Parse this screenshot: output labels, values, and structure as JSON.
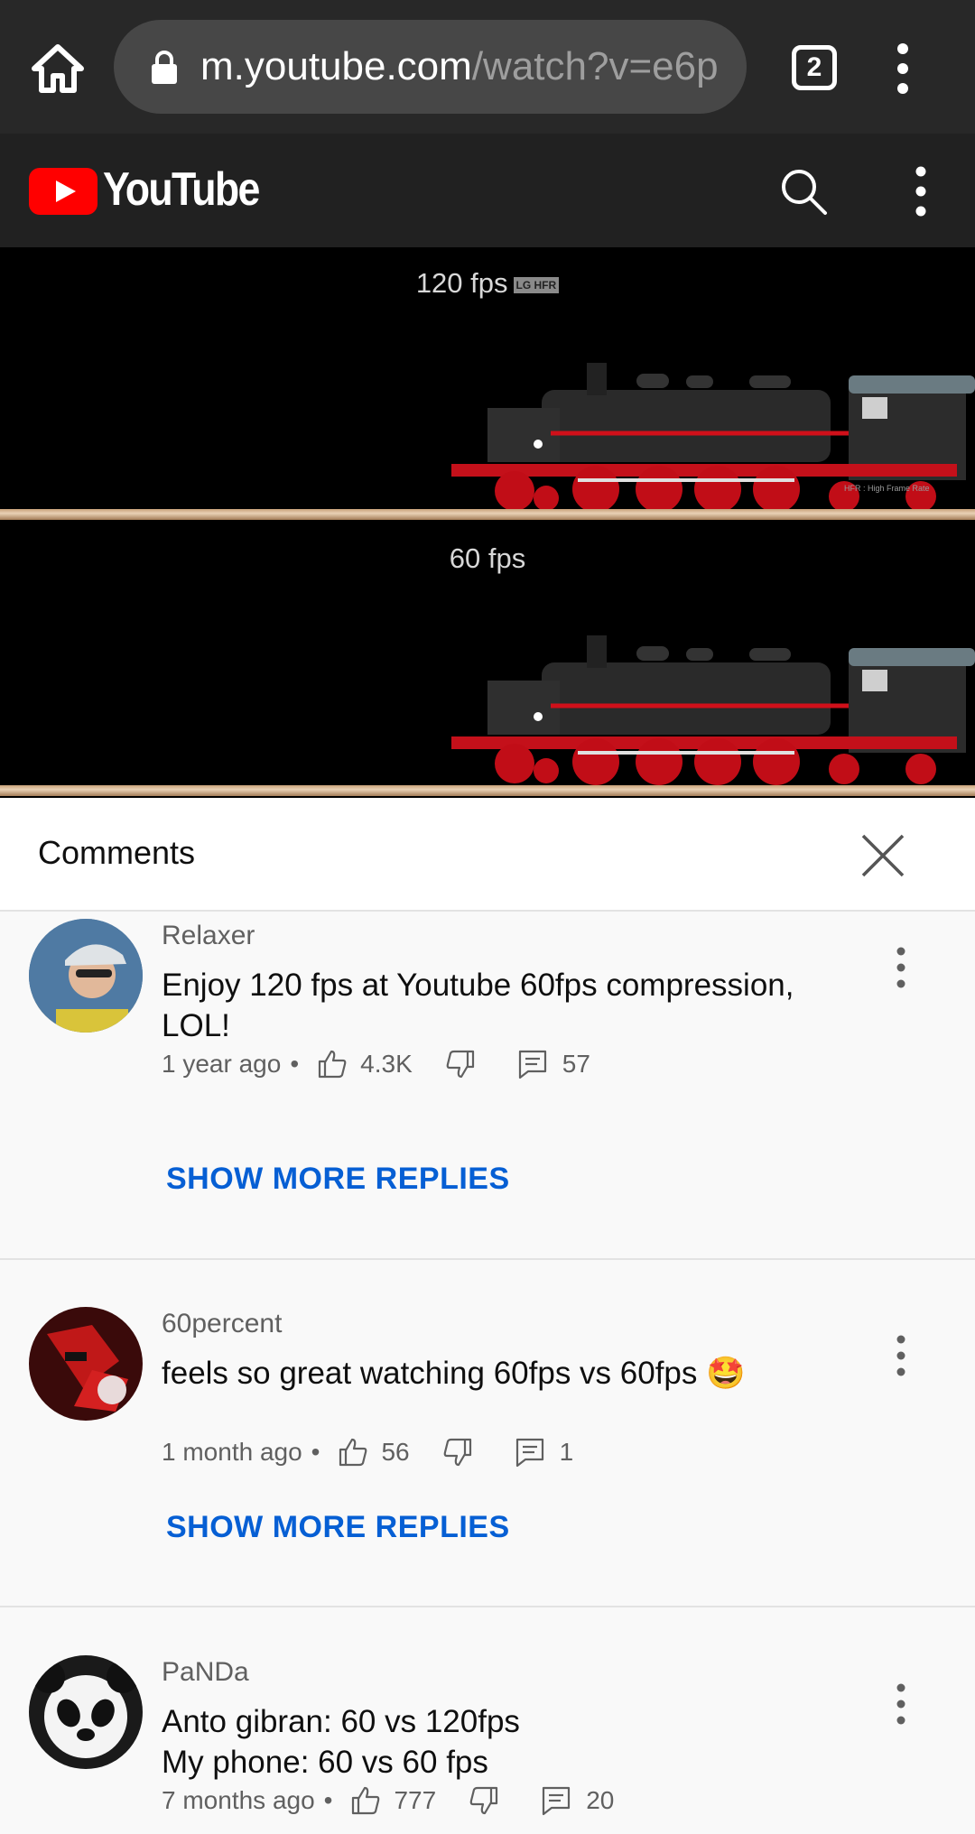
{
  "browser": {
    "url_host": "m.youtube.com",
    "url_path": "/watch?v=e6p",
    "tab_count": "2"
  },
  "youtube": {
    "wordmark": "YouTube"
  },
  "video": {
    "top_label": "120 fps",
    "top_badge": "LG HFR",
    "bottom_label": "60 fps",
    "watermark": "HFR : High Frame Rate"
  },
  "comments": {
    "title": "Comments",
    "items": [
      {
        "author": "Relaxer",
        "text_line1": "Enjoy 120 fps at Youtube 60fps compression,",
        "text_line2": "LOL!",
        "time": "1 year ago",
        "likes": "4.3K",
        "replies": "57",
        "more_replies": "SHOW MORE REPLIES"
      },
      {
        "author": "60percent",
        "text_line1": "feels so great watching 60fps vs 60fps 🤩",
        "time": "1 month ago",
        "likes": "56",
        "replies": "1",
        "more_replies": "SHOW MORE REPLIES"
      },
      {
        "author": "PaNDa",
        "text_line1": "Anto gibran: 60 vs 120fps",
        "text_line2": "My phone: 60 vs 60 fps",
        "time": "7 months ago",
        "likes": "777",
        "replies": "20"
      }
    ]
  },
  "colors": {
    "browser_bg": "#282828",
    "youtube_red": "#ff0000",
    "link_blue": "#065fd4"
  }
}
